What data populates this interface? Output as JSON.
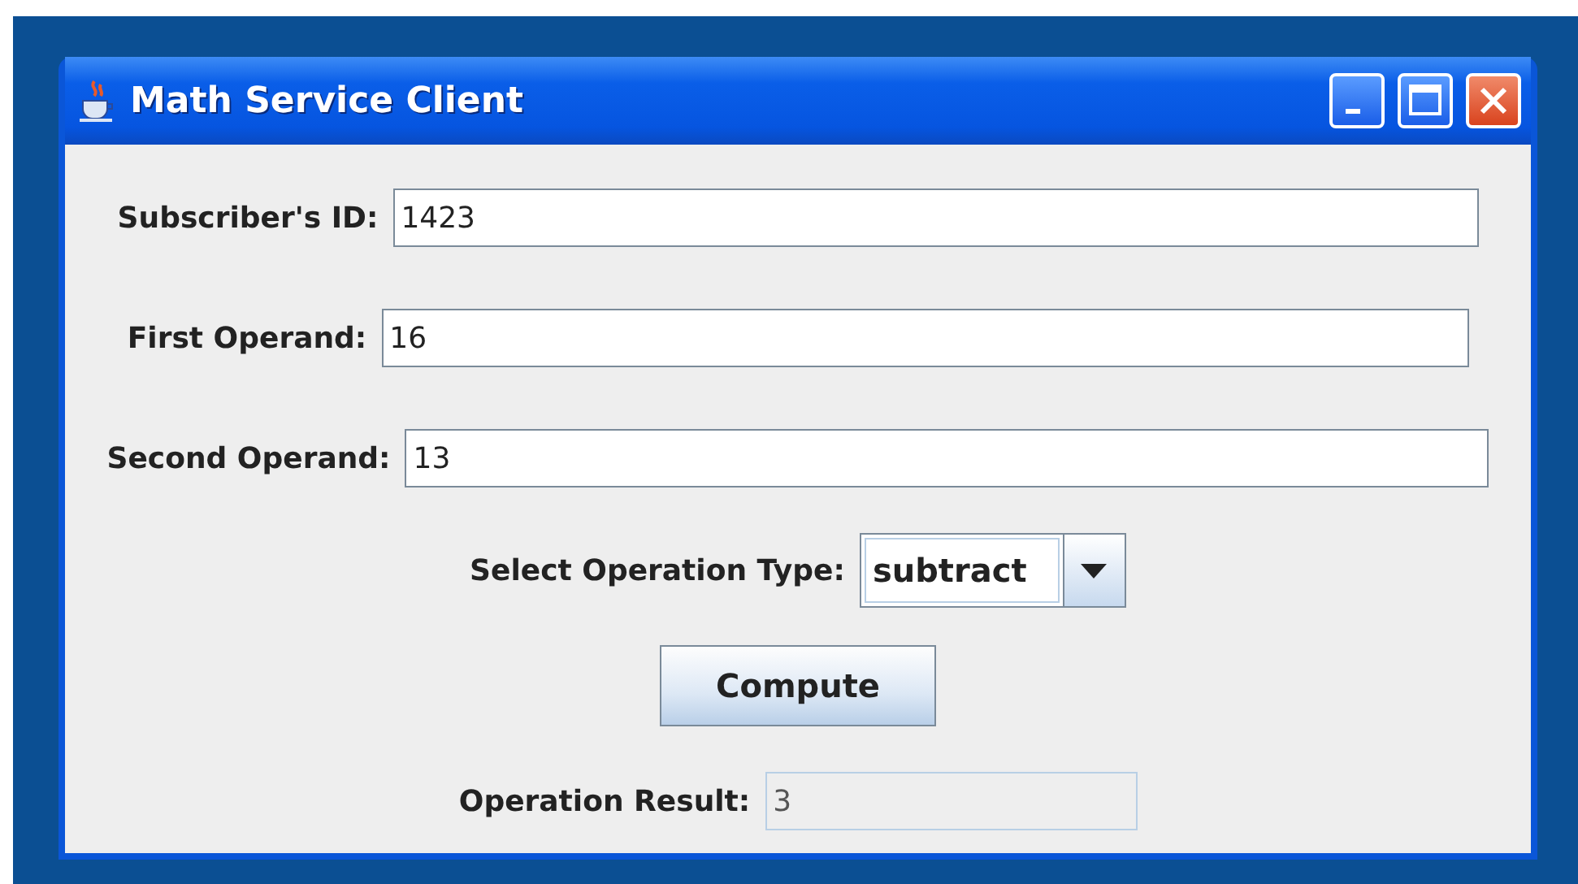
{
  "window": {
    "title": "Math Service Client"
  },
  "fields": [
    {
      "label": "Subscriber's ID:",
      "value": "1423"
    },
    {
      "label": "First Operand:",
      "value": "16"
    },
    {
      "label": "Second Operand:",
      "value": "13"
    }
  ],
  "operation": {
    "label": "Select Operation Type:",
    "value": "subtract"
  },
  "compute_button": "Compute",
  "result": {
    "label": "Operation Result:",
    "value": "3",
    "disabled": true
  }
}
